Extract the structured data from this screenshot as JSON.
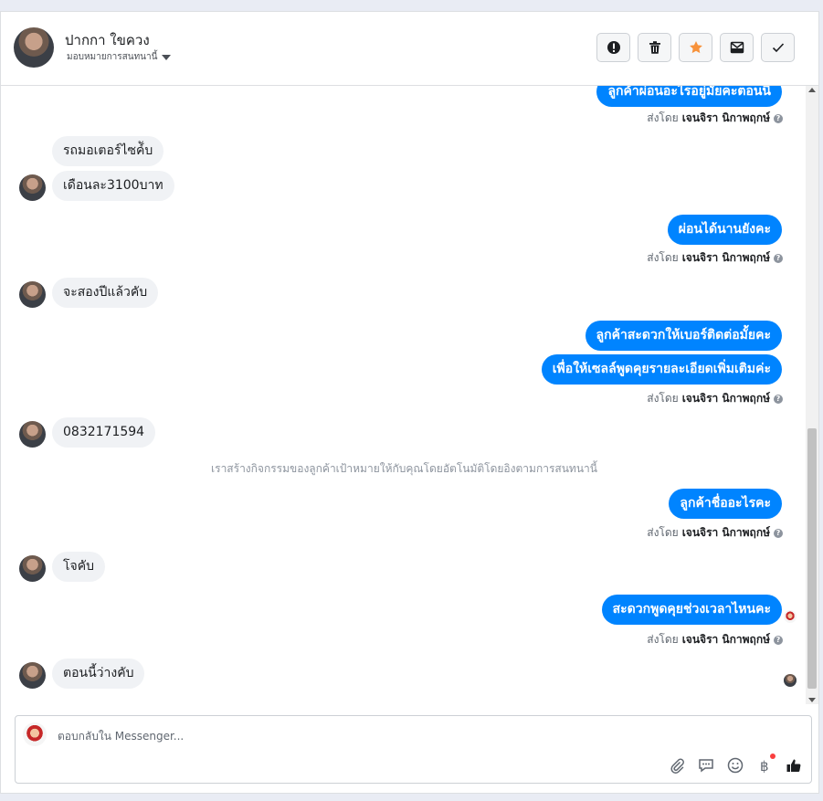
{
  "header": {
    "name": "ปากกา ใขควง",
    "assign_label": "มอบหมายการสนทนานี้",
    "actions": [
      {
        "name": "report-button",
        "icon": "alert-icon"
      },
      {
        "name": "delete-button",
        "icon": "trash-icon"
      },
      {
        "name": "star-button",
        "icon": "star-icon"
      },
      {
        "name": "move-button",
        "icon": "mailbox-icon"
      },
      {
        "name": "done-button",
        "icon": "check-icon"
      }
    ]
  },
  "sent_by": {
    "prefix": "ส่งโดย",
    "agent": "เจนจิรา นิกาพฤกษ์"
  },
  "messages": {
    "m1": "ลูกค้าผ่อนอะไรอยู่มั้ยคะตอนนี้",
    "m2": "รถมอเตอร์ไซค์ับ",
    "m3": "เดือนละ3100บาท",
    "m4": "ผ่อนได้นานยังคะ",
    "m5": "จะสองปีแล้วคับ",
    "m6": "ลูกค้าสะดวกให้เบอร์ติดต่อมั้ยคะ",
    "m7": "เพื่อให้เซลล์พูดคุยรายละเอียดเพิ่มเติมค่ะ",
    "m8": "0832171594",
    "m9": "ลูกค้าชื่ออะไรคะ",
    "m10": "โจคับ",
    "m11": "สะดวกพูดคุยช่วงเวลาไหนคะ",
    "m12": "ตอนนี้ว่างคับ"
  },
  "system_note": "เราสร้างกิจกรรมของลูกค้าเป้าหมายให้กับคุณโดยอัตโนมัติโดยอิงตามการสนทนานี้",
  "composer": {
    "placeholder": "ตอบกลับใน Messenger...",
    "tools": [
      "attach-icon",
      "saved-reply-icon",
      "emoji-icon",
      "baht-icon",
      "like-icon"
    ]
  },
  "colors": {
    "accent": "#0084ff",
    "star": "#f7923b",
    "incoming_bubble": "#f0f2f5"
  }
}
